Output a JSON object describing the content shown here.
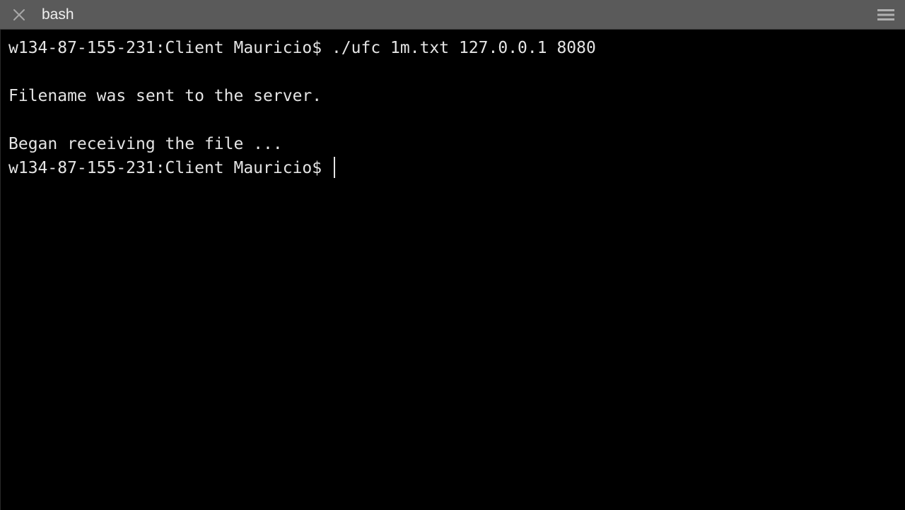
{
  "tab": {
    "title": "bash",
    "close_icon": "close-icon",
    "menu_icon": "hamburger-menu-icon"
  },
  "terminal": {
    "prompt": "w134-87-155-231:Client Mauricio$ ",
    "lines": [
      "w134-87-155-231:Client Mauricio$ ./ufc 1m.txt 127.0.0.1 8080",
      "",
      "Filename was sent to the server.",
      "",
      "Began receiving the file ...",
      "w134-87-155-231:Client Mauricio$ "
    ]
  },
  "colors": {
    "tabbar_background": "#5a5a5a",
    "terminal_background": "#000000",
    "terminal_text": "#e4e4e4",
    "tab_title": "#efefef"
  }
}
